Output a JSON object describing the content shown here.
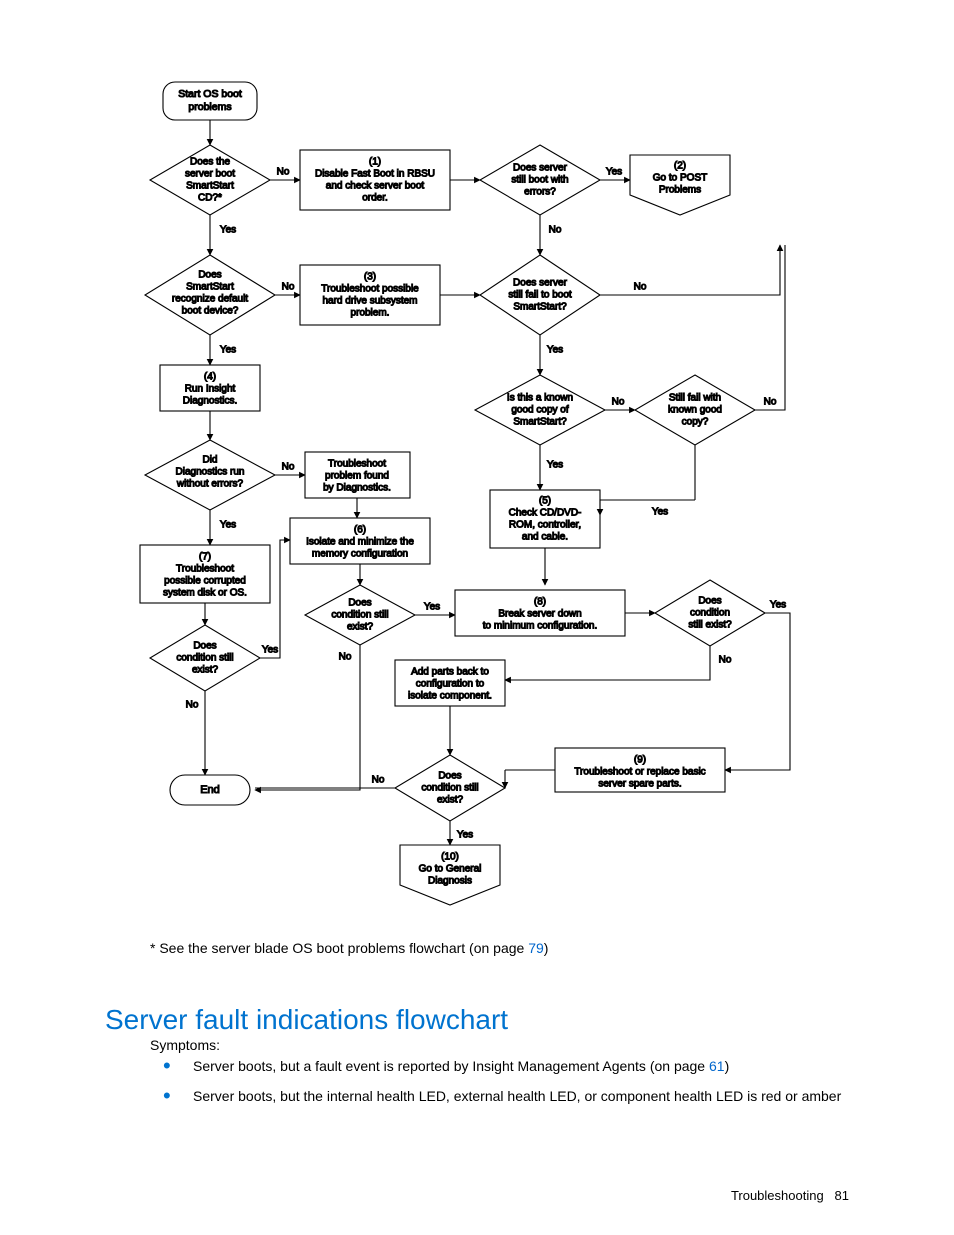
{
  "flowchart": {
    "start": "Start OS boot\nproblems",
    "d_boot_cd": "Does the\nserver boot\nSmartStart\nCD?*",
    "p1": "(1)\nDisable Fast Boot in RBSU\nand check server boot\norder.",
    "d_still_errors": "Does server\nstill boot with\nerrors?",
    "p2": "(2)\nGo to POST\nProblems",
    "d_recognize": "Does\nSmartStart\nrecognize default\nboot device?",
    "p3": "(3)\nTroubleshoot possible\nhard drive subsystem\nproblem.",
    "d_fail_boot_ss": "Does server\nstill fail to boot\nSmartStart?",
    "p4": "(4)\nRun Insight\nDiagnostics.",
    "d_known_copy": "Is this a known\ngood copy of\nSmartStart?",
    "d_still_fail_copy": "Still fail with\nknown good\ncopy?",
    "d_diag_errors": "Did\nDiagnostics run\nwithout errors?",
    "p_trouble_diag": "Troubleshoot\nproblem found\nby Diagnostics.",
    "p5": "(5)\nCheck CD/DVD-\nROM, controller,\nand cable.",
    "p6": "(6)\nIsolate and minimize the\nmemory configuration",
    "p7": "(7)\nTroubleshoot\npossible corrupted\nsystem disk or OS.",
    "d_cond1": "Does\ncondition still\nexist?",
    "p8": "(8)\nBreak server down\nto minimum configuration.",
    "d_cond2": "Does\ncondition\nstill exist?",
    "d_cond3": "Does\ncondition still\nexist?",
    "p_addparts": "Add parts back to\nconfiguration to\nisolate component.",
    "end": "End",
    "d_cond4": "Does\ncondition still\nexist?",
    "p9": "(9)\nTroubleshoot or replace basic\nserver spare parts.",
    "p10": "(10)\nGo to General\nDiagnosis",
    "labels": {
      "yes": "Yes",
      "no": "No"
    }
  },
  "note_before": "* See the server blade OS boot problems flowchart (on page ",
  "note_link": "79",
  "note_after": ")",
  "heading": "Server fault indications flowchart",
  "symptoms_label": "Symptoms:",
  "symptom1_before": "Server boots, but a fault event is reported by Insight Management Agents (on page ",
  "symptom1_link": "61",
  "symptom1_after": ")",
  "symptom2": "Server boots, but the internal health LED, external health LED, or component health LED is red or amber",
  "footer_section": "Troubleshooting",
  "footer_page": "81"
}
